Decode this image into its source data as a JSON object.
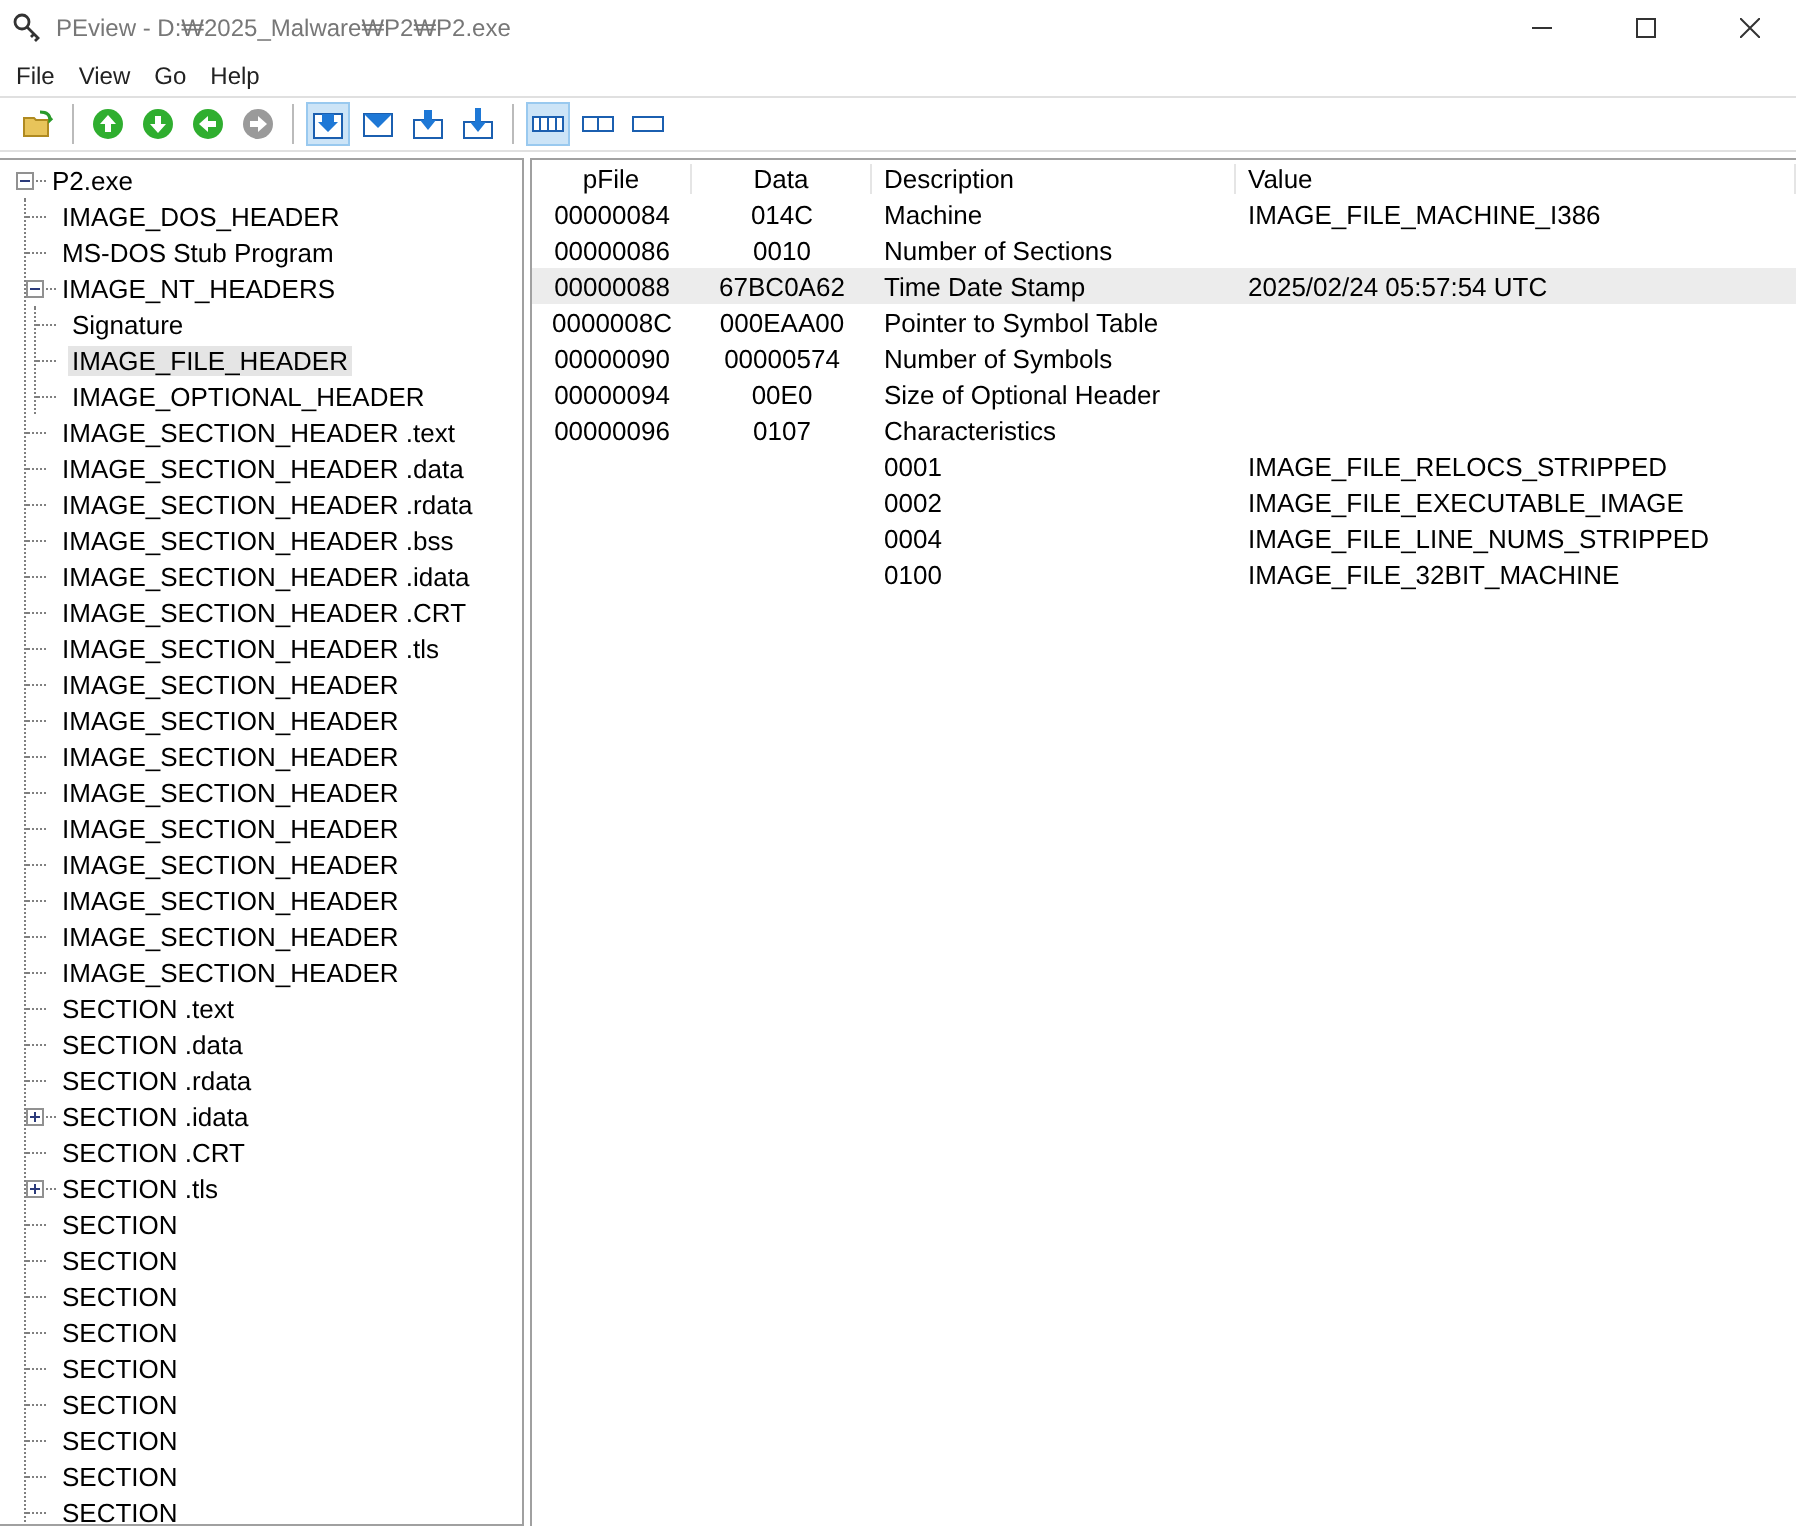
{
  "window": {
    "title": "PEview - D:₩2025_Malware₩P2₩P2.exe"
  },
  "menu": [
    "File",
    "View",
    "Go",
    "Help"
  ],
  "toolbar": [
    {
      "kind": "open",
      "selected": false
    },
    {
      "kind": "sep"
    },
    {
      "kind": "up",
      "selected": false,
      "disabled": false
    },
    {
      "kind": "down",
      "selected": false,
      "disabled": false
    },
    {
      "kind": "back",
      "selected": false,
      "disabled": false
    },
    {
      "kind": "forward",
      "selected": false,
      "disabled": true
    },
    {
      "kind": "sep"
    },
    {
      "kind": "arrow-box",
      "selected": true
    },
    {
      "kind": "envelope",
      "selected": false
    },
    {
      "kind": "arrow-right-box",
      "selected": false
    },
    {
      "kind": "arrow-down-box",
      "selected": false
    },
    {
      "kind": "sep"
    },
    {
      "kind": "view-4",
      "selected": true
    },
    {
      "kind": "view-2",
      "selected": false
    },
    {
      "kind": "view-1",
      "selected": false
    }
  ],
  "tree": [
    {
      "label": "P2.exe",
      "selected": false,
      "expanded": true,
      "children": [
        {
          "label": "IMAGE_DOS_HEADER",
          "selected": false
        },
        {
          "label": "MS-DOS Stub Program",
          "selected": false
        },
        {
          "label": "IMAGE_NT_HEADERS",
          "selected": false,
          "expanded": true,
          "children": [
            {
              "label": "Signature",
              "selected": false
            },
            {
              "label": "IMAGE_FILE_HEADER",
              "selected": true
            },
            {
              "label": "IMAGE_OPTIONAL_HEADER",
              "selected": false
            }
          ]
        },
        {
          "label": "IMAGE_SECTION_HEADER .text",
          "selected": false
        },
        {
          "label": "IMAGE_SECTION_HEADER .data",
          "selected": false
        },
        {
          "label": "IMAGE_SECTION_HEADER .rdata",
          "selected": false
        },
        {
          "label": "IMAGE_SECTION_HEADER .bss",
          "selected": false
        },
        {
          "label": "IMAGE_SECTION_HEADER .idata",
          "selected": false
        },
        {
          "label": "IMAGE_SECTION_HEADER .CRT",
          "selected": false
        },
        {
          "label": "IMAGE_SECTION_HEADER .tls",
          "selected": false
        },
        {
          "label": "IMAGE_SECTION_HEADER",
          "selected": false
        },
        {
          "label": "IMAGE_SECTION_HEADER",
          "selected": false
        },
        {
          "label": "IMAGE_SECTION_HEADER",
          "selected": false
        },
        {
          "label": "IMAGE_SECTION_HEADER",
          "selected": false
        },
        {
          "label": "IMAGE_SECTION_HEADER",
          "selected": false
        },
        {
          "label": "IMAGE_SECTION_HEADER",
          "selected": false
        },
        {
          "label": "IMAGE_SECTION_HEADER",
          "selected": false
        },
        {
          "label": "IMAGE_SECTION_HEADER",
          "selected": false
        },
        {
          "label": "IMAGE_SECTION_HEADER",
          "selected": false
        },
        {
          "label": "SECTION .text",
          "selected": false
        },
        {
          "label": "SECTION .data",
          "selected": false
        },
        {
          "label": "SECTION .rdata",
          "selected": false
        },
        {
          "label": "SECTION .idata",
          "selected": false,
          "expanded": false
        },
        {
          "label": "SECTION .CRT",
          "selected": false
        },
        {
          "label": "SECTION .tls",
          "selected": false,
          "expanded": false
        },
        {
          "label": "SECTION",
          "selected": false
        },
        {
          "label": "SECTION",
          "selected": false
        },
        {
          "label": "SECTION",
          "selected": false
        },
        {
          "label": "SECTION",
          "selected": false
        },
        {
          "label": "SECTION",
          "selected": false
        },
        {
          "label": "SECTION",
          "selected": false
        },
        {
          "label": "SECTION",
          "selected": false
        },
        {
          "label": "SECTION",
          "selected": false
        },
        {
          "label": "SECTION",
          "selected": false
        }
      ]
    }
  ],
  "table": {
    "columns": [
      "pFile",
      "Data",
      "Description",
      "Value"
    ],
    "rows": [
      {
        "cells": [
          "00000084",
          "014C",
          "Machine",
          "IMAGE_FILE_MACHINE_I386"
        ],
        "selected": false
      },
      {
        "cells": [
          "00000086",
          "0010",
          "Number of Sections",
          ""
        ],
        "selected": false
      },
      {
        "cells": [
          "00000088",
          "67BC0A62",
          "Time Date Stamp",
          "2025/02/24  05:57:54 UTC"
        ],
        "selected": true
      },
      {
        "cells": [
          "0000008C",
          "000EAA00",
          "Pointer to Symbol Table",
          ""
        ],
        "selected": false
      },
      {
        "cells": [
          "00000090",
          "00000574",
          "Number of Symbols",
          ""
        ],
        "selected": false
      },
      {
        "cells": [
          "00000094",
          "00E0",
          "Size of Optional Header",
          ""
        ],
        "selected": false
      },
      {
        "cells": [
          "00000096",
          "0107",
          "Characteristics",
          ""
        ],
        "selected": false
      },
      {
        "cells": [
          "",
          "",
          "0001",
          "IMAGE_FILE_RELOCS_STRIPPED"
        ],
        "selected": false
      },
      {
        "cells": [
          "",
          "",
          "0002",
          "IMAGE_FILE_EXECUTABLE_IMAGE"
        ],
        "selected": false
      },
      {
        "cells": [
          "",
          "",
          "0004",
          "IMAGE_FILE_LINE_NUMS_STRIPPED"
        ],
        "selected": false
      },
      {
        "cells": [
          "",
          "",
          "0100",
          "IMAGE_FILE_32BIT_MACHINE"
        ],
        "selected": false
      }
    ]
  }
}
